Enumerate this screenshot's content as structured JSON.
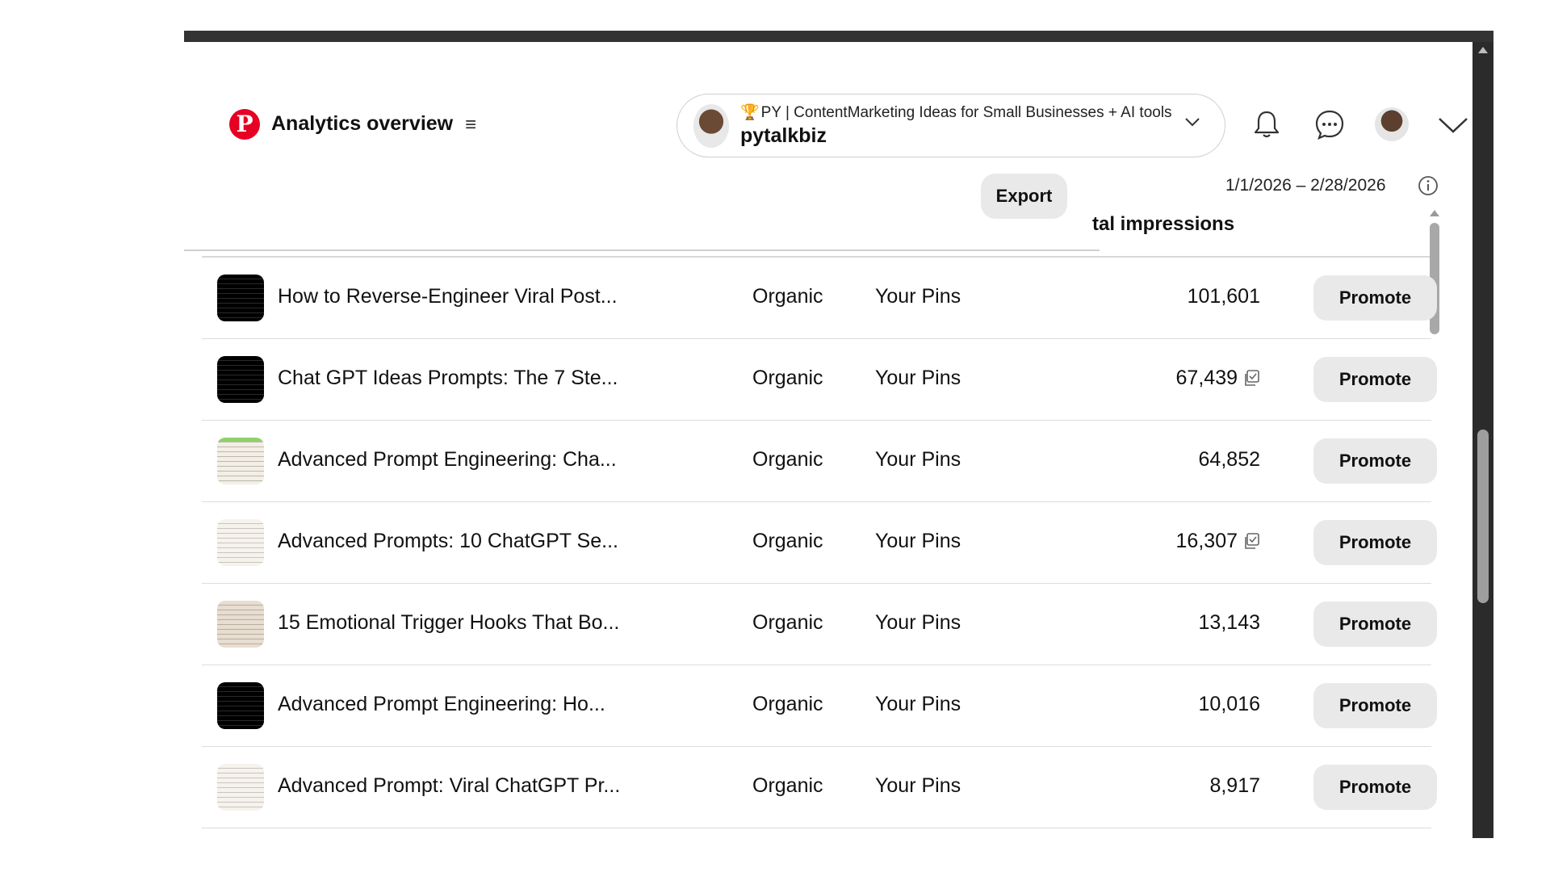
{
  "header": {
    "page_title": "Analytics overview",
    "menu_icon": "hamburger-menu-icon",
    "account": {
      "name": "PY | ContentMarketing Ideas for Small Businesses + AI tools",
      "name_prefix_icon": "🏆",
      "username": "pytalkbiz"
    },
    "icons": [
      "notifications-bell-icon",
      "messages-icon",
      "user-avatar",
      "chevron-down-icon"
    ]
  },
  "date_range": "1/1/2026 – 2/28/2026",
  "toolbar": {
    "export_label": "Export"
  },
  "table": {
    "visible_header": "tal impressions",
    "rows": [
      {
        "title": "How to Reverse-Engineer Viral Post...",
        "source": "Organic",
        "type": "Your Pins",
        "impressions": "101,601",
        "promote": "Promote"
      },
      {
        "title": "Chat GPT Ideas Prompts: The 7 Ste...",
        "source": "Organic",
        "type": "Your Pins",
        "impressions": "67,439",
        "promote": "Promote"
      },
      {
        "title": "Advanced Prompt Engineering: Cha...",
        "source": "Organic",
        "type": "Your Pins",
        "impressions": "64,852",
        "promote": "Promote"
      },
      {
        "title": "Advanced Prompts: 10 ChatGPT Se...",
        "source": "Organic",
        "type": "Your Pins",
        "impressions": "16,307",
        "promote": "Promote"
      },
      {
        "title": "15 Emotional Trigger Hooks That Bo...",
        "source": "Organic",
        "type": "Your Pins",
        "impressions": "13,143",
        "promote": "Promote"
      },
      {
        "title": "Advanced Prompt Engineering: Ho...",
        "source": "Organic",
        "type": "Your Pins",
        "impressions": "10,016",
        "promote": "Promote"
      },
      {
        "title": "Advanced Prompt: Viral ChatGPT Pr...",
        "source": "Organic",
        "type": "Your Pins",
        "impressions": "8,917",
        "promote": "Promote"
      }
    ]
  },
  "colors": {
    "brand": "#e60023",
    "button_bg": "#e9e9e9",
    "divider": "#dcdcdc"
  }
}
